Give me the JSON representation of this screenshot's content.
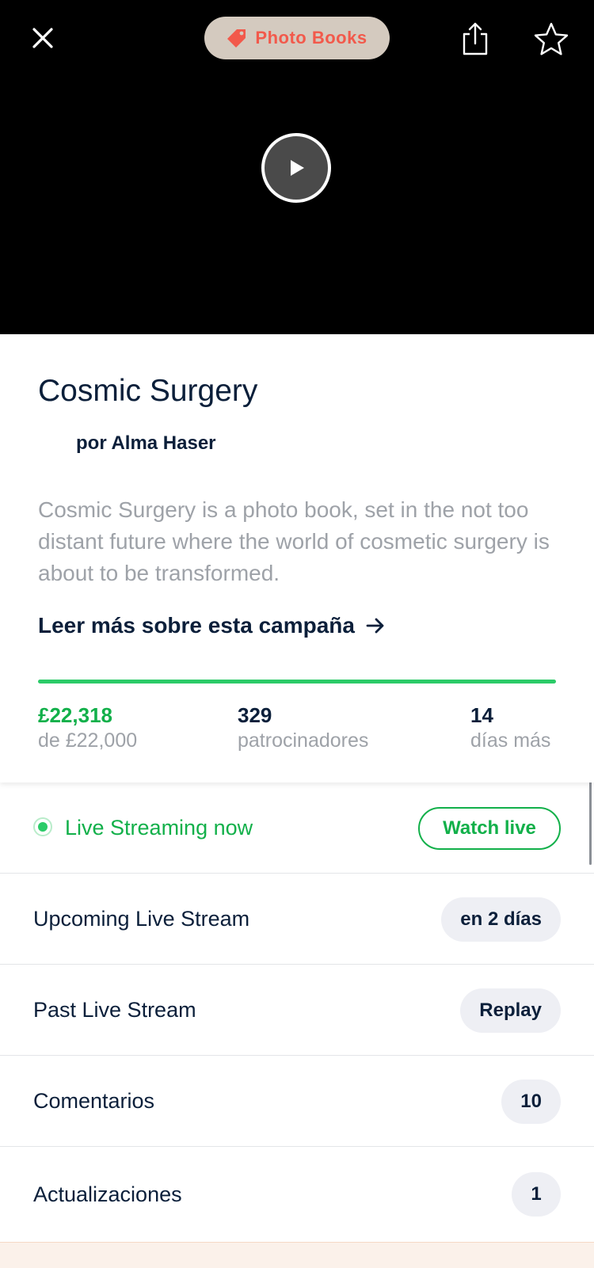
{
  "header": {
    "category_label": "Photo Books",
    "close_icon": "close-icon",
    "share_icon": "share-icon",
    "favorite_icon": "star-icon",
    "play_icon": "play-icon"
  },
  "campaign": {
    "title": "Cosmic Surgery",
    "author": "por Alma Haser",
    "description": "Cosmic Surgery is a photo book, set in the not too distant future where the world of cosmetic surgery is about to be transformed.",
    "read_more": "Leer más sobre esta campaña"
  },
  "stats": {
    "progress_fraction": 1.0,
    "funded_value": "£22,318",
    "funded_label": "de £22,000",
    "backers_value": "329",
    "backers_label": "patrocinadores",
    "days_value": "14",
    "days_label": "días más"
  },
  "rows": {
    "live": {
      "label": "Live Streaming now",
      "button": "Watch live"
    },
    "upcoming": {
      "label": "Upcoming Live Stream",
      "badge": "en 2 días"
    },
    "past": {
      "label": "Past Live Stream",
      "badge": "Replay"
    },
    "comments": {
      "label": "Comentarios",
      "badge": "10"
    },
    "updates": {
      "label": "Actualizaciones",
      "badge": "1"
    }
  },
  "colors": {
    "accent_green": "#12b04a",
    "progress_green": "#2bcb68",
    "category_text": "#f2594b",
    "navy_text": "#0b1f3a"
  }
}
